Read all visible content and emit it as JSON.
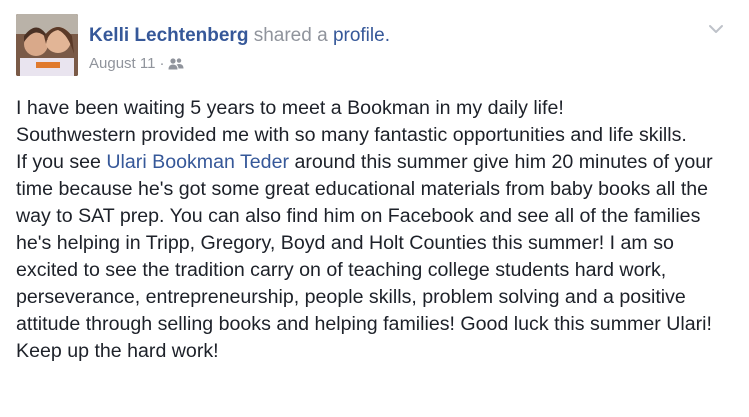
{
  "post": {
    "author": "Kelli Lechtenberg",
    "action": "shared a",
    "target_link": "profile",
    "target_suffix": ".",
    "date": "August 11",
    "separator": "·",
    "audience_icon": "friends-icon",
    "options_icon": "chevron-down-icon",
    "colors": {
      "link": "#365899",
      "meta": "#90949c",
      "text": "#1d2129"
    },
    "body": {
      "line1": "I have been waiting 5 years to meet a Bookman in my daily life!",
      "line2": "Southwestern provided me with so many fantastic opportunities and life skills.",
      "para2_start": "If you see ",
      "mention": "Ulari Bookman Teder",
      "para2_rest": " around this summer give him 20 minutes of your time because he's got some great educational materials from baby books all the way to SAT prep. You can also find him on Facebook and see all of the families he's helping in Tripp, Gregory, Boyd and Holt Counties this summer! I am so excited to see the tradition carry on of teaching college students hard work, perseverance, entrepreneurship, people skills, problem solving and a positive attitude through selling books and helping families! Good luck this summer Ulari! Keep up the hard work!"
    }
  }
}
